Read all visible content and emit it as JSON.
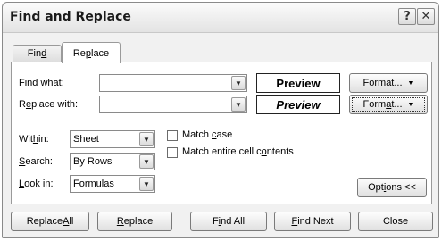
{
  "window": {
    "title": "Find and Replace",
    "help_glyph": "?",
    "close_glyph": "✕"
  },
  "tabs": {
    "find": {
      "pre": "Fin",
      "key": "d",
      "post": ""
    },
    "replace": {
      "pre": "Re",
      "key": "p",
      "post": "lace"
    }
  },
  "find_row": {
    "label_pre": "Fi",
    "label_key": "n",
    "label_post": "d what:",
    "value": "",
    "preview": "Preview",
    "format_pre": "For",
    "format_key": "m",
    "format_post": "at..."
  },
  "replace_row": {
    "label_pre": "R",
    "label_key": "e",
    "label_post": "place with:",
    "value": "",
    "preview": "Preview",
    "format_pre": "Form",
    "format_key": "a",
    "format_post": "t..."
  },
  "options": {
    "within": {
      "label_pre": "Wit",
      "label_key": "h",
      "label_post": "in:",
      "value": "Sheet"
    },
    "search": {
      "label_pre": "",
      "label_key": "S",
      "label_post": "earch:",
      "value": "By Rows"
    },
    "look_in": {
      "label_pre": "",
      "label_key": "L",
      "label_post": "ook in:",
      "value": "Formulas"
    },
    "match_case": {
      "pre": "Match ",
      "key": "c",
      "post": "ase",
      "checked": false
    },
    "match_entire": {
      "pre": "Match entire cell c",
      "key": "o",
      "post": "ntents",
      "checked": false
    },
    "options_button": {
      "pre": "Opt",
      "key": "i",
      "post": "ons <<"
    }
  },
  "buttons": {
    "replace_all": {
      "pre": "Replace ",
      "key": "A",
      "post": "ll"
    },
    "replace": {
      "pre": "",
      "key": "R",
      "post": "eplace"
    },
    "find_all": {
      "pre": "F",
      "key": "i",
      "post": "nd All"
    },
    "find_next": {
      "pre": "",
      "key": "F",
      "post": "ind Next"
    },
    "close": {
      "pre": "Close",
      "key": "",
      "post": ""
    }
  },
  "icons": {
    "dropdown": "▼"
  }
}
